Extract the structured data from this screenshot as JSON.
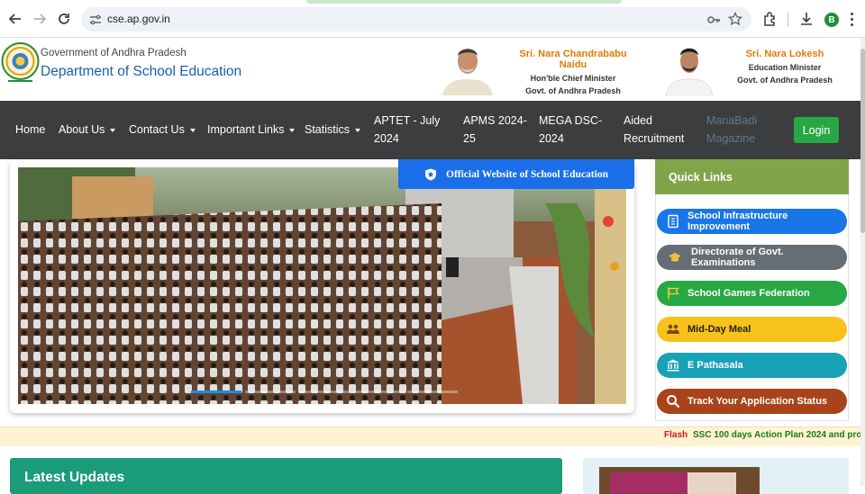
{
  "browser": {
    "url": "cse.ap.gov.in",
    "profile_initial": "B"
  },
  "header": {
    "gov_line": "Government of Andhra Pradesh",
    "dept_line": "Department of School Education",
    "leaders": [
      {
        "name": "Sri. Nara Chandrababu Naidu",
        "designation": "Hon'ble Chief Minister",
        "govt": "Govt. of Andhra Pradesh"
      },
      {
        "name": "Sri. Nara Lokesh",
        "designation": "Education Minister",
        "govt": "Govt. of Andhra Pradesh"
      }
    ]
  },
  "nav": {
    "home": "Home",
    "about": "About Us",
    "contact": "Contact Us",
    "important": "Important Links",
    "statistics": "Statistics",
    "aptet_1": "APTET - July",
    "aptet_2": "2024",
    "apms_1": "APMS 2024-",
    "apms_2": "25",
    "mega_1": "MEGA DSC-",
    "mega_2": "2024",
    "aided_1": "Aided",
    "aided_2": "Recruitment",
    "mana_1": "ManaBadi",
    "mana_2": "Magazine",
    "login": "Login"
  },
  "carousel": {
    "banner": "Official Website of School Education",
    "active_slide": 1,
    "slide_count": 5
  },
  "quick_links": {
    "title": "Quick Links",
    "items": [
      {
        "label": "School Infrastructure Improvement",
        "color": "#1976e8",
        "icon": "building-icon"
      },
      {
        "label": "Directorate of Govt. Examinations",
        "color": "#656d75",
        "icon": "graduation-cap-icon"
      },
      {
        "label": "School Games Federation",
        "color": "#27a844",
        "icon": "flag-icon"
      },
      {
        "label": "Mid-Day Meal",
        "color": "#f7c21a",
        "icon": "users-icon"
      },
      {
        "label": "E Pathasala",
        "color": "#17a2b8",
        "icon": "institution-icon"
      },
      {
        "label": "Track Your Application Status",
        "color": "#a8431a",
        "icon": "search-icon"
      }
    ]
  },
  "flash": {
    "label": "Flash",
    "text": "SSC 100 days Action Plan 2024 and pro"
  },
  "latest_updates": {
    "title": "Latest Updates"
  }
}
